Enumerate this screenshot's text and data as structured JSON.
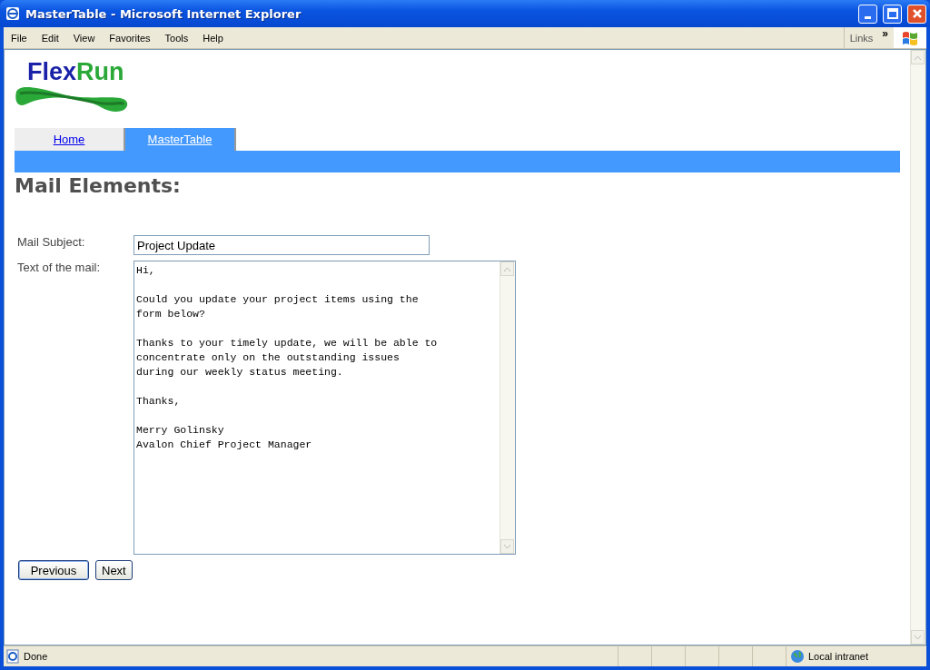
{
  "window": {
    "title": "MasterTable - Microsoft Internet Explorer"
  },
  "menu": [
    "File",
    "Edit",
    "View",
    "Favorites",
    "Tools",
    "Help"
  ],
  "links_label": "Links",
  "links_chevron": "»",
  "logo": [
    "Flex",
    "Run"
  ],
  "tabs": [
    {
      "label": "Home",
      "selected": false
    },
    {
      "label": "MasterTable",
      "selected": true
    }
  ],
  "heading": "Mail Elements:",
  "form": {
    "subject_label": "Mail Subject:",
    "subject_value": "Project Update",
    "body_label": "Text of the mail:",
    "body_value": "Hi,\n\nCould you update your project items using the\nform below?\n\nThanks to your timely update, we will be able to\nconcentrate only on the outstanding issues\nduring our weekly status meeting.\n\nThanks,\n\nMerry Golinsky\nAvalon Chief Project Manager"
  },
  "buttons": [
    "Previous",
    "Next"
  ],
  "status_bar": {
    "status": "Done",
    "zone": "Local intranet"
  }
}
